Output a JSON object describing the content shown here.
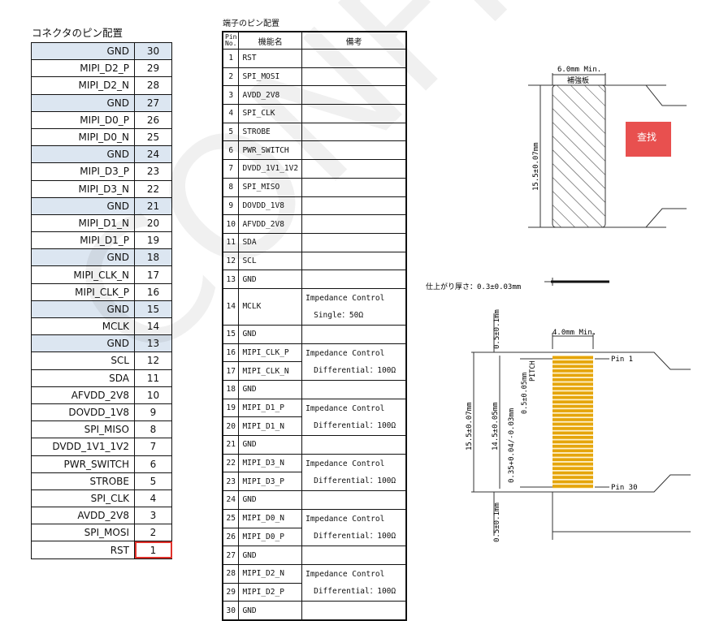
{
  "left": {
    "title": "コネクタのピン配置",
    "rows": [
      {
        "name": "GND",
        "num": "30",
        "gnd": true
      },
      {
        "name": "MIPI_D2_P",
        "num": "29"
      },
      {
        "name": "MIPI_D2_N",
        "num": "28"
      },
      {
        "name": "GND",
        "num": "27",
        "gnd": true
      },
      {
        "name": "MIPI_D0_P",
        "num": "26"
      },
      {
        "name": "MIPI_D0_N",
        "num": "25"
      },
      {
        "name": "GND",
        "num": "24",
        "gnd": true
      },
      {
        "name": "MIPI_D3_P",
        "num": "23"
      },
      {
        "name": "MIPI_D3_N",
        "num": "22"
      },
      {
        "name": "GND",
        "num": "21",
        "gnd": true
      },
      {
        "name": "MIPI_D1_N",
        "num": "20"
      },
      {
        "name": "MIPI_D1_P",
        "num": "19"
      },
      {
        "name": "GND",
        "num": "18",
        "gnd": true
      },
      {
        "name": "MIPI_CLK_N",
        "num": "17"
      },
      {
        "name": "MIPI_CLK_P",
        "num": "16"
      },
      {
        "name": "GND",
        "num": "15",
        "gnd": true
      },
      {
        "name": "MCLK",
        "num": "14"
      },
      {
        "name": "GND",
        "num": "13",
        "gnd": true
      },
      {
        "name": "SCL",
        "num": "12"
      },
      {
        "name": "SDA",
        "num": "11"
      },
      {
        "name": "AFVDD_2V8",
        "num": "10"
      },
      {
        "name": "DOVDD_1V8",
        "num": "9"
      },
      {
        "name": "SPI_MISO",
        "num": "8"
      },
      {
        "name": "DVDD_1V1_1V2",
        "num": "7"
      },
      {
        "name": "PWR_SWITCH",
        "num": "6"
      },
      {
        "name": "STROBE",
        "num": "5"
      },
      {
        "name": "SPI_CLK",
        "num": "4"
      },
      {
        "name": "AVDD_2V8",
        "num": "3"
      },
      {
        "name": "SPI_MOSI",
        "num": "2"
      },
      {
        "name": "RST",
        "num": "1",
        "highlight": true
      }
    ]
  },
  "mid": {
    "title": "端子のピン配置",
    "header": {
      "pin": "Pin No.",
      "fn": "機能名",
      "note": "備考"
    },
    "rows": [
      {
        "pin": "1",
        "fn": "RST"
      },
      {
        "pin": "2",
        "fn": "SPI_MOSI"
      },
      {
        "pin": "3",
        "fn": "AVDD_2V8"
      },
      {
        "pin": "4",
        "fn": "SPI_CLK"
      },
      {
        "pin": "5",
        "fn": "STROBE"
      },
      {
        "pin": "6",
        "fn": "PWR_SWITCH"
      },
      {
        "pin": "7",
        "fn": "DVDD_1V1_1V2"
      },
      {
        "pin": "8",
        "fn": "SPI_MISO"
      },
      {
        "pin": "9",
        "fn": "DOVDD_1V8"
      },
      {
        "pin": "10",
        "fn": "AFVDD_2V8"
      },
      {
        "pin": "11",
        "fn": "SDA"
      },
      {
        "pin": "12",
        "fn": "SCL"
      },
      {
        "pin": "13",
        "fn": "GND"
      },
      {
        "pin": "14",
        "fn": "MCLK",
        "note": [
          "Impedance Control",
          "Single：50Ω"
        ],
        "span": 2
      },
      {
        "pin": "15",
        "fn": "GND"
      },
      {
        "pin": "16",
        "fn": "MIPI_CLK_P",
        "note": [
          "Impedance Control",
          "Differential：100Ω"
        ]
      },
      {
        "pin": "17",
        "fn": "MIPI_CLK_N",
        "cont": true
      },
      {
        "pin": "18",
        "fn": "GND"
      },
      {
        "pin": "19",
        "fn": "MIPI_D1_P",
        "note": [
          "Impedance Control",
          "Differential：100Ω"
        ]
      },
      {
        "pin": "20",
        "fn": "MIPI_D1_N",
        "cont": true
      },
      {
        "pin": "21",
        "fn": "GND"
      },
      {
        "pin": "22",
        "fn": "MIPI_D3_N",
        "note": [
          "Impedance Control",
          "Differential：100Ω"
        ]
      },
      {
        "pin": "23",
        "fn": "MIPI_D3_P",
        "cont": true
      },
      {
        "pin": "24",
        "fn": "GND"
      },
      {
        "pin": "25",
        "fn": "MIPI_D0_N",
        "note": [
          "Impedance Control",
          "Differential：100Ω"
        ]
      },
      {
        "pin": "26",
        "fn": "MIPI_D0_P",
        "cont": true
      },
      {
        "pin": "27",
        "fn": "GND"
      },
      {
        "pin": "28",
        "fn": "MIPI_D2_N",
        "note": [
          "Impedance Control",
          "Differential：100Ω"
        ]
      },
      {
        "pin": "29",
        "fn": "MIPI_D2_P",
        "cont": true
      },
      {
        "pin": "30",
        "fn": "GND"
      }
    ]
  },
  "drawing_top": {
    "width_label": "6.0mm Min.",
    "plate_label": "補強板",
    "height_label": "15.5±0.07mm"
  },
  "drawing_bottom": {
    "thickness_label": "仕上がり厚さ：0.3±0.03mm",
    "width_label": "4.0mm Min.",
    "top_gap": "0.5±0.1mm",
    "bottom_gap": "0.5±0.1mm",
    "total_height": "15.5±0.07mm",
    "pin_span": "14.5±0.05mm",
    "pitch": "0.5±0.05mm",
    "pitch_word": "PITCH",
    "finger_width": "0.35+0.04/-0.03mm",
    "pin1": "Pin 1",
    "pin30": "Pin 30"
  },
  "find_button": "查找",
  "watermark": "CONFIDENTIAL"
}
